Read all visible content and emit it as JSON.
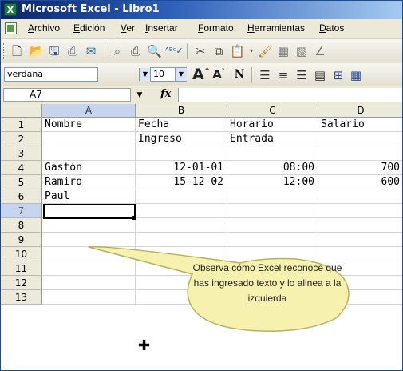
{
  "window": {
    "title": "Microsoft Excel - Libro1",
    "app_icon": "excel-icon"
  },
  "menu": {
    "items": [
      "Archivo",
      "Edición",
      "Ver",
      "Insertar",
      "Formato",
      "Herramientas",
      "Datos"
    ]
  },
  "format_toolbar": {
    "font_name": "verdana",
    "font_size": "10"
  },
  "formula_bar": {
    "name_box": "A7",
    "fx_label": "fx",
    "formula": ""
  },
  "sheet": {
    "columns": [
      "A",
      "B",
      "C",
      "D"
    ],
    "rows": [
      "1",
      "2",
      "3",
      "4",
      "5",
      "6",
      "7",
      "8",
      "9",
      "10",
      "11",
      "12",
      "13"
    ],
    "cells": {
      "A1": "Nombre",
      "B1": "Fecha",
      "C1": "Horario",
      "D1": "Salario",
      "B2": "Ingreso",
      "C2": "Entrada",
      "A4": "Gastón",
      "B4": "12-01-01",
      "C4": "08:00",
      "D4": "700",
      "A5": "Ramiro",
      "B5": "15-12-02",
      "C5": "12:00",
      "D5": "600",
      "A6": "Paul"
    },
    "active_cell": "A7"
  },
  "callout": {
    "text": "Observa cómo Excel reconoce que has ingresado texto y lo alinea a la izquierda",
    "fill": "#f7f1b0",
    "stroke": "#b7b060"
  }
}
